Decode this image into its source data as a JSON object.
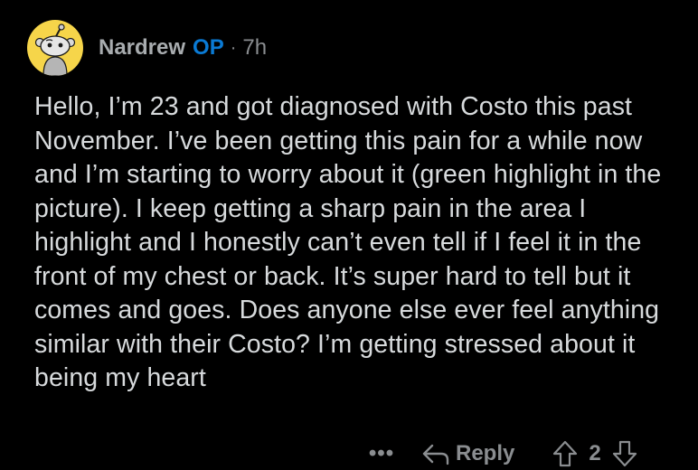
{
  "comment": {
    "username": "Nardrew",
    "op_badge": "OP",
    "separator": "·",
    "timestamp": "7h",
    "avatar_icon": "snoo-avatar-icon",
    "body": "Hello, I’m 23 and got diagnosed with Costo this past November. I’ve been getting this pain for a while now and I’m starting to worry about it (green highlight in the picture). I keep getting a sharp pain in the area I highlight and I honestly can’t even tell if I feel it in the front of my chest or back. It’s super hard to tell but it comes and goes. Does anyone else ever feel anything similar with their Costo? I’m getting stressed about it being my heart"
  },
  "actions": {
    "more_label": "•••",
    "reply_label": "Reply",
    "reply_icon": "reply-arrow-icon",
    "upvote_icon": "upvote-arrow-icon",
    "downvote_icon": "downvote-arrow-icon",
    "score": "2"
  },
  "colors": {
    "background": "#000000",
    "text": "#d7dadc",
    "muted": "#8a8d90",
    "op_accent": "#0a7ad4",
    "avatar_bg": "#f6d54a"
  }
}
